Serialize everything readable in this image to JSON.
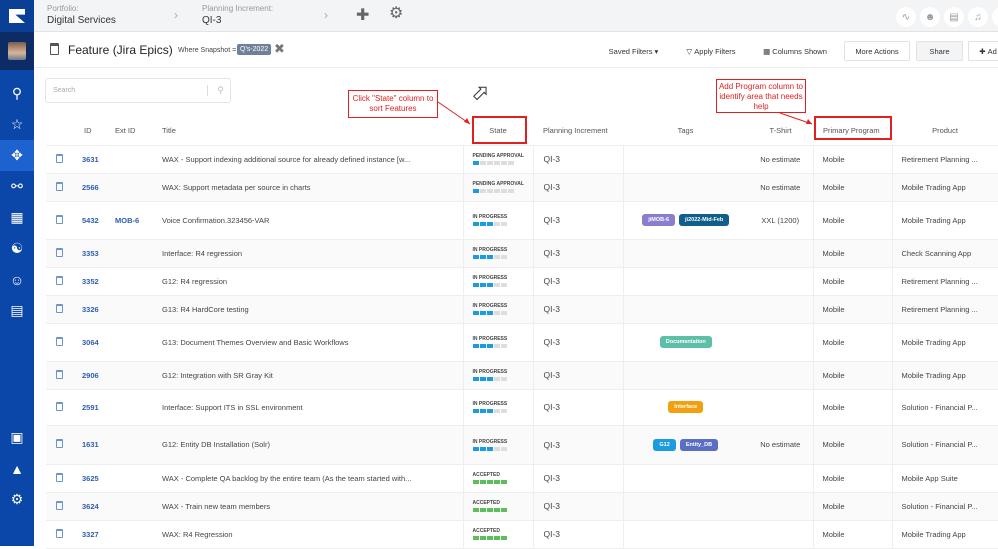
{
  "topbar": {
    "portfolio_label": "Portfolio:",
    "portfolio": "Digital Services",
    "pi_label": "Planning Increment:",
    "pi": "QI-3"
  },
  "titlebar": {
    "title": "Feature (Jira Epics)",
    "where": "Where Snapshot =",
    "chip": "Q's-2022",
    "saved_filters": "Saved Filters",
    "apply_filters": "Apply Filters",
    "columns_shown": "Columns Shown",
    "more_actions": "More Actions",
    "share": "Share",
    "add": "Ad"
  },
  "search": {
    "placeholder": "Search"
  },
  "annotations": {
    "state": "Click \"State\" column to sort Features",
    "program": "Add Program column to identify area that needs help"
  },
  "columns": [
    "ID",
    "Ext ID",
    "Title",
    "State",
    "Planning Increment",
    "Tags",
    "T-Shirt",
    "Primary Program",
    "Product"
  ],
  "colors": {
    "sidebar": "#0b47a8",
    "progress": "#1b9be0",
    "accepted": "#5cbf5c",
    "annotation": "#e02020"
  },
  "rows": [
    {
      "id": "3631",
      "ext": "",
      "title": "WAX - Support indexing additional source for already defined instance [w...",
      "state": "PENDING APPROVAL",
      "filled": 1,
      "segments": 6,
      "pi": "QI-3",
      "tags": [],
      "tshirt": "No estimate",
      "program": "Mobile",
      "product": "Retirement Planning ..."
    },
    {
      "id": "2566",
      "ext": "",
      "title": "WAX: Support metadata per source in charts",
      "state": "PENDING APPROVAL",
      "filled": 1,
      "segments": 6,
      "pi": "QI-3",
      "tags": [],
      "tshirt": "No estimate",
      "program": "Mobile",
      "product": "Mobile Trading App"
    },
    {
      "id": "5432",
      "ext": "MOB-6",
      "title": "Voice Confirmation.323456-VAR",
      "state": "IN PROGRESS",
      "filled": 3,
      "segments": 5,
      "pi": "QI-3",
      "tags": [
        {
          "text": "jiMOB-6",
          "color": "#8a7fcf"
        },
        {
          "text": "ji2022-Mid-Feb",
          "color": "#0e5f8a"
        }
      ],
      "tshirt": "XXL (1200)",
      "program": "Mobile",
      "product": "Mobile Trading App"
    },
    {
      "id": "3353",
      "ext": "",
      "title": "Interface: R4 regression",
      "state": "IN PROGRESS",
      "filled": 3,
      "segments": 5,
      "pi": "QI-3",
      "tags": [],
      "tshirt": "",
      "program": "Mobile",
      "product": "Check Scanning App"
    },
    {
      "id": "3352",
      "ext": "",
      "title": "G12: R4 regression",
      "state": "IN PROGRESS",
      "filled": 3,
      "segments": 5,
      "pi": "QI-3",
      "tags": [],
      "tshirt": "",
      "program": "Mobile",
      "product": "Retirement Planning ..."
    },
    {
      "id": "3326",
      "ext": "",
      "title": "G13: R4 HardCore testing",
      "state": "IN PROGRESS",
      "filled": 3,
      "segments": 5,
      "pi": "QI-3",
      "tags": [],
      "tshirt": "",
      "program": "Mobile",
      "product": "Retirement Planning ..."
    },
    {
      "id": "3064",
      "ext": "",
      "title": "G13: Document Themes Overview and Basic Workflows",
      "state": "IN PROGRESS",
      "filled": 3,
      "segments": 5,
      "pi": "QI-3",
      "tags": [
        {
          "text": "Documentation",
          "color": "#5dbfa8"
        }
      ],
      "tshirt": "",
      "program": "Mobile",
      "product": "Mobile Trading App"
    },
    {
      "id": "2906",
      "ext": "",
      "title": "G12: Integration with SR Gray Kit",
      "state": "IN PROGRESS",
      "filled": 3,
      "segments": 5,
      "pi": "QI-3",
      "tags": [],
      "tshirt": "",
      "program": "Mobile",
      "product": "Mobile Trading App"
    },
    {
      "id": "2591",
      "ext": "",
      "title": "Interface: Support ITS in SSL environment",
      "state": "IN PROGRESS",
      "filled": 3,
      "segments": 5,
      "pi": "QI-3",
      "tags": [
        {
          "text": "Interface",
          "color": "#f0a010"
        }
      ],
      "tshirt": "",
      "program": "Mobile",
      "product": "Solution - Financial P..."
    },
    {
      "id": "1631",
      "ext": "",
      "title": "G12: Entity DB Installation (Solr)",
      "state": "IN PROGRESS",
      "filled": 3,
      "segments": 5,
      "pi": "QI-3",
      "tags": [
        {
          "text": "G12",
          "color": "#1b9be0"
        },
        {
          "text": "Entity_DB",
          "color": "#5a6fc4"
        }
      ],
      "tshirt": "No estimate",
      "program": "Mobile",
      "product": "Solution - Financial P..."
    },
    {
      "id": "3625",
      "ext": "",
      "title": "WAX - Complete QA backlog by the entire team (As the team started with...",
      "state": "ACCEPTED",
      "filled": 5,
      "segments": 5,
      "pi": "QI-3",
      "tags": [],
      "tshirt": "",
      "program": "Mobile",
      "product": "Mobile App Suite"
    },
    {
      "id": "3624",
      "ext": "",
      "title": "WAX - Train new team members",
      "state": "ACCEPTED",
      "filled": 5,
      "segments": 5,
      "pi": "QI-3",
      "tags": [],
      "tshirt": "",
      "program": "Mobile",
      "product": "Solution - Financial P..."
    },
    {
      "id": "3327",
      "ext": "",
      "title": "WAX: R4 Regression",
      "state": "ACCEPTED",
      "filled": 5,
      "segments": 5,
      "pi": "QI-3",
      "tags": [],
      "tshirt": "",
      "program": "Mobile",
      "product": "Mobile Trading App"
    }
  ]
}
